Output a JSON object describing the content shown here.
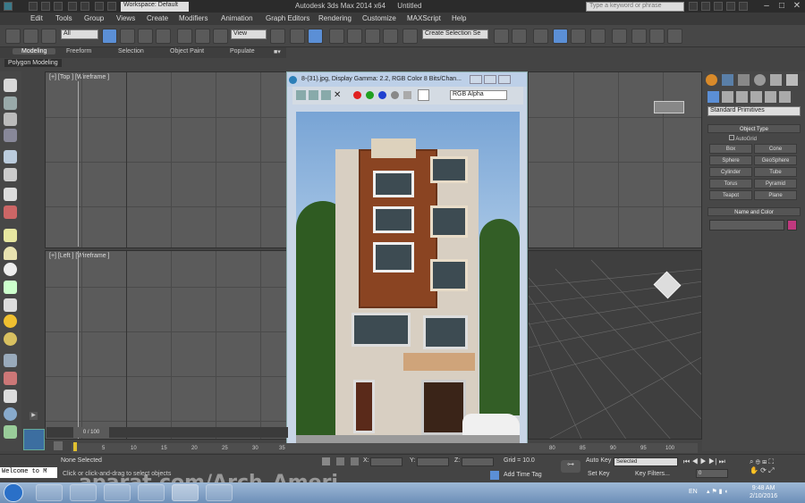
{
  "app": {
    "title": "Autodesk 3ds Max  2014 x64",
    "file": "Untitled",
    "workspace": "Workspace: Default",
    "search_placeholder": "Type a keyword or phrase"
  },
  "menu": [
    "Edit",
    "Tools",
    "Group",
    "Views",
    "Create",
    "Modifiers",
    "Animation",
    "Graph Editors",
    "Rendering",
    "Customize",
    "MAXScript",
    "Help"
  ],
  "toolbar": {
    "filter": "All",
    "ref_coord": "View",
    "selection_set": "Create Selection Se"
  },
  "ribbon": {
    "tabs": [
      "Modeling",
      "Freeform",
      "Selection",
      "Object Paint",
      "Populate"
    ],
    "active": "Modeling",
    "panel": "Polygon Modeling"
  },
  "viewports": {
    "top": "[+] [Top ] [Wireframe ]",
    "left": "[+] [Left ] [Wireframe ]"
  },
  "image_window": {
    "title": "8-(31).jpg, Display Gamma: 2.2, RGB Color 8 Bits/Chan...",
    "channel": "RGB Alpha"
  },
  "command_panel": {
    "category": "Standard Primitives",
    "object_type": "Object Type",
    "autogrid": "AutoGrid",
    "buttons": [
      "Box",
      "Cone",
      "Sphere",
      "GeoSphere",
      "Cylinder",
      "Tube",
      "Torus",
      "Pyramid",
      "Teapot",
      "Plane"
    ],
    "name_and_color": "Name and Color",
    "accent": "#c0397f"
  },
  "timeline": {
    "frame": "0 / 100",
    "ticks": [
      "0",
      "5",
      "10",
      "15",
      "20",
      "25",
      "30",
      "35",
      "80",
      "85",
      "90",
      "95",
      "100"
    ]
  },
  "status": {
    "selection": "None Selected",
    "prompt": "Click or click-and-drag to select objects",
    "x_label": "X:",
    "y_label": "Y:",
    "z_label": "Z:",
    "grid": "Grid = 10.0",
    "add_time_tag": "Add Time Tag",
    "auto_key": "Auto Key",
    "auto_key_mode": "Selected",
    "set_key": "Set Key",
    "key_filters": "Key Filters...",
    "frame_field": "0",
    "listener": "Welcome to M"
  },
  "taskbar": {
    "lang": "EN",
    "time": "9:48 AM",
    "date": "2/10/2016"
  },
  "watermark": "aparat.com/Arch_Ameri"
}
